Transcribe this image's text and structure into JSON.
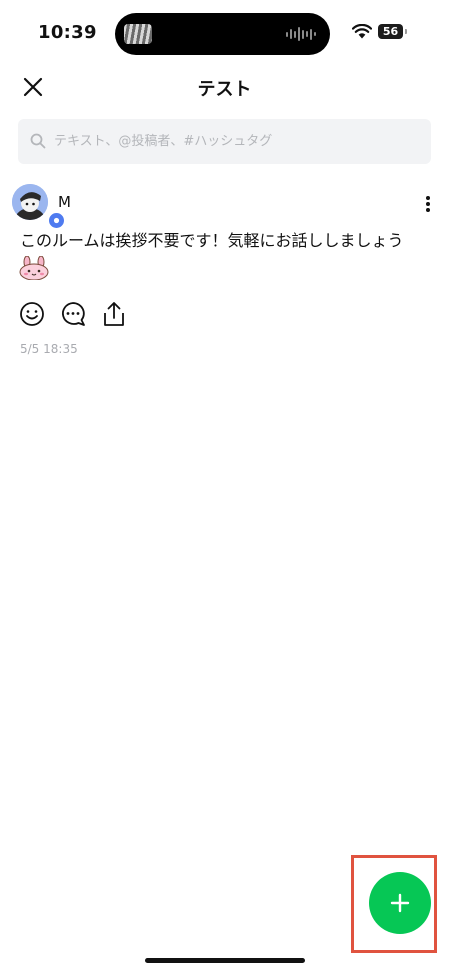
{
  "status_bar": {
    "time": "10:39",
    "battery": "56",
    "icons": [
      "wifi-icon",
      "battery-icon"
    ]
  },
  "header": {
    "title": "テスト",
    "close_icon": "close-icon"
  },
  "search": {
    "placeholder": "テキスト、@投稿者、#ハッシュタグ",
    "value": "",
    "icon": "search-icon"
  },
  "post": {
    "author": "M",
    "text": "このルームは挨拶不要です！気軽にお話ししましょう",
    "sticker": "bunny-sticker",
    "timestamp": "5/5 18:35",
    "actions": [
      "smile-icon",
      "comment-icon",
      "share-icon"
    ],
    "menu_icon": "more-vertical-icon"
  },
  "fab": {
    "icon": "plus-icon",
    "color": "#06c755"
  },
  "colors": {
    "accent": "#06c755",
    "highlight": "#e0533f",
    "search_bg": "#f2f3f5",
    "timestamp": "#a9abb0"
  }
}
